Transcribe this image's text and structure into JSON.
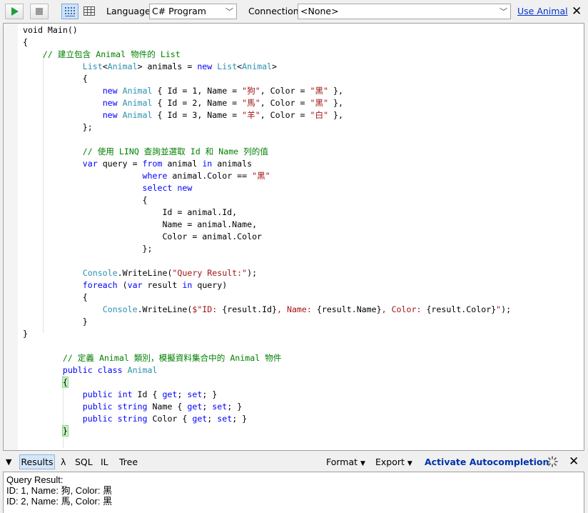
{
  "toolbar": {
    "language_label": "Language",
    "language_value": "C# Program",
    "connection_label": "Connection",
    "connection_value": "<None>",
    "use_link": "Use Animal"
  },
  "code_lines": [
    [
      [
        "void Main()",
        "pl"
      ]
    ],
    [
      [
        "{",
        "pl"
      ]
    ],
    [
      [
        "    ",
        "pl"
      ],
      [
        "// 建立包含 Animal 物件的 List",
        "cm"
      ]
    ],
    [
      [
        "            ",
        "pl"
      ],
      [
        "List",
        "ty"
      ],
      [
        "<",
        "pl"
      ],
      [
        "Animal",
        "ty"
      ],
      [
        "> animals = ",
        "pl"
      ],
      [
        "new ",
        "kw"
      ],
      [
        "List",
        "ty"
      ],
      [
        "<",
        "pl"
      ],
      [
        "Animal",
        "ty"
      ],
      [
        ">",
        "pl"
      ]
    ],
    [
      [
        "            {",
        "pl"
      ]
    ],
    [
      [
        "                ",
        "pl"
      ],
      [
        "new ",
        "kw"
      ],
      [
        "Animal",
        "ty"
      ],
      [
        " { Id = 1, Name = ",
        "pl"
      ],
      [
        "\"狗\"",
        "st"
      ],
      [
        ", Color = ",
        "pl"
      ],
      [
        "\"黑\"",
        "st"
      ],
      [
        " },",
        "pl"
      ]
    ],
    [
      [
        "                ",
        "pl"
      ],
      [
        "new ",
        "kw"
      ],
      [
        "Animal",
        "ty"
      ],
      [
        " { Id = 2, Name = ",
        "pl"
      ],
      [
        "\"馬\"",
        "st"
      ],
      [
        ", Color = ",
        "pl"
      ],
      [
        "\"黑\"",
        "st"
      ],
      [
        " },",
        "pl"
      ]
    ],
    [
      [
        "                ",
        "pl"
      ],
      [
        "new ",
        "kw"
      ],
      [
        "Animal",
        "ty"
      ],
      [
        " { Id = 3, Name = ",
        "pl"
      ],
      [
        "\"羊\"",
        "st"
      ],
      [
        ", Color = ",
        "pl"
      ],
      [
        "\"白\"",
        "st"
      ],
      [
        " },",
        "pl"
      ]
    ],
    [
      [
        "            };",
        "pl"
      ]
    ],
    [],
    [
      [
        "            ",
        "pl"
      ],
      [
        "// 使用 LINQ 查詢並選取 Id 和 Name 列的值",
        "cm"
      ]
    ],
    [
      [
        "            ",
        "pl"
      ],
      [
        "var ",
        "kw"
      ],
      [
        "query = ",
        "pl"
      ],
      [
        "from ",
        "kw"
      ],
      [
        "animal ",
        "pl"
      ],
      [
        "in ",
        "kw"
      ],
      [
        "animals",
        "pl"
      ]
    ],
    [
      [
        "                        ",
        "pl"
      ],
      [
        "where ",
        "kw"
      ],
      [
        "animal.Color == ",
        "pl"
      ],
      [
        "\"黑\"",
        "st"
      ]
    ],
    [
      [
        "                        ",
        "pl"
      ],
      [
        "select new",
        "kw"
      ]
    ],
    [
      [
        "                        {",
        "pl"
      ]
    ],
    [
      [
        "                            Id = animal.Id,",
        "pl"
      ]
    ],
    [
      [
        "                            Name = animal.Name,",
        "pl"
      ]
    ],
    [
      [
        "                            Color = animal.Color",
        "pl"
      ]
    ],
    [
      [
        "                        };",
        "pl"
      ]
    ],
    [],
    [
      [
        "            ",
        "pl"
      ],
      [
        "Console",
        "ty"
      ],
      [
        ".WriteLine(",
        "pl"
      ],
      [
        "\"Query Result:\"",
        "st"
      ],
      [
        ");",
        "pl"
      ]
    ],
    [
      [
        "            ",
        "pl"
      ],
      [
        "foreach ",
        "kw"
      ],
      [
        "(",
        "pl"
      ],
      [
        "var ",
        "kw"
      ],
      [
        "result ",
        "pl"
      ],
      [
        "in ",
        "kw"
      ],
      [
        "query)",
        "pl"
      ]
    ],
    [
      [
        "            {",
        "pl"
      ]
    ],
    [
      [
        "                ",
        "pl"
      ],
      [
        "Console",
        "ty"
      ],
      [
        ".WriteLine(",
        "pl"
      ],
      [
        "$\"ID: ",
        "st"
      ],
      [
        "{result.Id}",
        "pl"
      ],
      [
        ", Name: ",
        "st"
      ],
      [
        "{result.Name}",
        "pl"
      ],
      [
        ", Color: ",
        "st"
      ],
      [
        "{result.Color}",
        "pl"
      ],
      [
        "\"",
        "st"
      ],
      [
        ");",
        "pl"
      ]
    ],
    [
      [
        "            }",
        "pl"
      ]
    ],
    [
      [
        "}",
        "pl"
      ]
    ],
    [],
    [
      [
        "        ",
        "pl"
      ],
      [
        "// 定義 Animal 類別，模擬資料集合中的 Animal 物件",
        "cm"
      ]
    ],
    [
      [
        "        ",
        "pl"
      ],
      [
        "public class ",
        "kw"
      ],
      [
        "Animal",
        "ty"
      ]
    ],
    [
      [
        "        ",
        "pl"
      ],
      [
        "{",
        "br"
      ]
    ],
    [
      [
        "            ",
        "pl"
      ],
      [
        "public int ",
        "kw"
      ],
      [
        "Id { ",
        "pl"
      ],
      [
        "get",
        "kw"
      ],
      [
        "; ",
        "pl"
      ],
      [
        "set",
        "kw"
      ],
      [
        "; }",
        "pl"
      ]
    ],
    [
      [
        "            ",
        "pl"
      ],
      [
        "public string ",
        "kw"
      ],
      [
        "Name { ",
        "pl"
      ],
      [
        "get",
        "kw"
      ],
      [
        "; ",
        "pl"
      ],
      [
        "set",
        "kw"
      ],
      [
        "; }",
        "pl"
      ]
    ],
    [
      [
        "            ",
        "pl"
      ],
      [
        "public string ",
        "kw"
      ],
      [
        "Color { ",
        "pl"
      ],
      [
        "get",
        "kw"
      ],
      [
        "; ",
        "pl"
      ],
      [
        "set",
        "kw"
      ],
      [
        "; }",
        "pl"
      ]
    ],
    [
      [
        "        ",
        "pl"
      ],
      [
        "}",
        "br"
      ]
    ]
  ],
  "results_bar": {
    "tabs": [
      "Results",
      "λ",
      "SQL",
      "IL",
      "Tree"
    ],
    "format": "Format",
    "export": "Export",
    "autocompletion": "Activate Autocompletion"
  },
  "output": {
    "lines": [
      "Query Result:",
      "ID: 1, Name: 狗, Color: 黑",
      "ID: 2, Name: 馬, Color: 黑"
    ]
  },
  "icons": {
    "run": "run-icon",
    "stop": "stop-icon",
    "rich-text": "rich-text-view-icon",
    "grid": "grid-view-icon",
    "close": "close-icon",
    "collapse": "collapse-triangle-icon",
    "spinner": "spinner-icon"
  }
}
